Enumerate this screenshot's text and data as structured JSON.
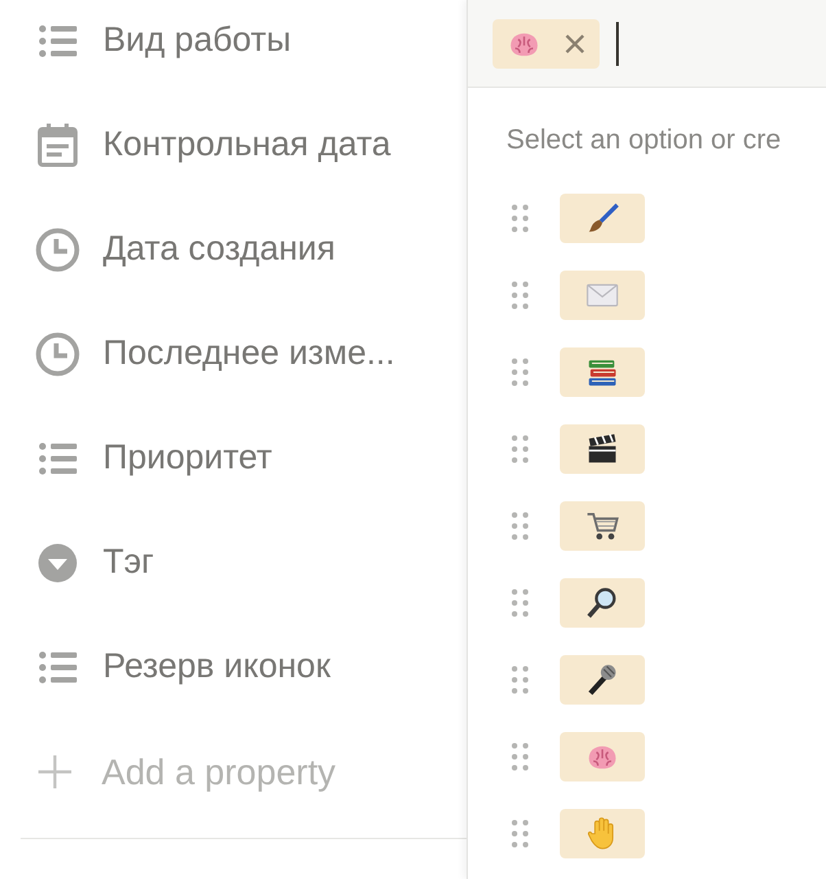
{
  "properties": [
    {
      "kind": "list",
      "label": "Вид работы"
    },
    {
      "kind": "calendar",
      "label": "Контрольная дата"
    },
    {
      "kind": "clock",
      "label": "Дата создания"
    },
    {
      "kind": "clock",
      "label": "Последнее изме..."
    },
    {
      "kind": "list",
      "label": "Приоритет"
    },
    {
      "kind": "select",
      "label": "Тэг"
    },
    {
      "kind": "list",
      "label": "Резерв иконок"
    }
  ],
  "add_property": "Add a property",
  "select_popup": {
    "selected_tags": [
      {
        "kind": "brain"
      }
    ],
    "hint": "Select an option or cre",
    "options": [
      {
        "kind": "paintbrush"
      },
      {
        "kind": "envelope"
      },
      {
        "kind": "books"
      },
      {
        "kind": "clapper"
      },
      {
        "kind": "cart"
      },
      {
        "kind": "magnifier"
      },
      {
        "kind": "microphone"
      },
      {
        "kind": "brain"
      },
      {
        "kind": "hand"
      }
    ]
  }
}
